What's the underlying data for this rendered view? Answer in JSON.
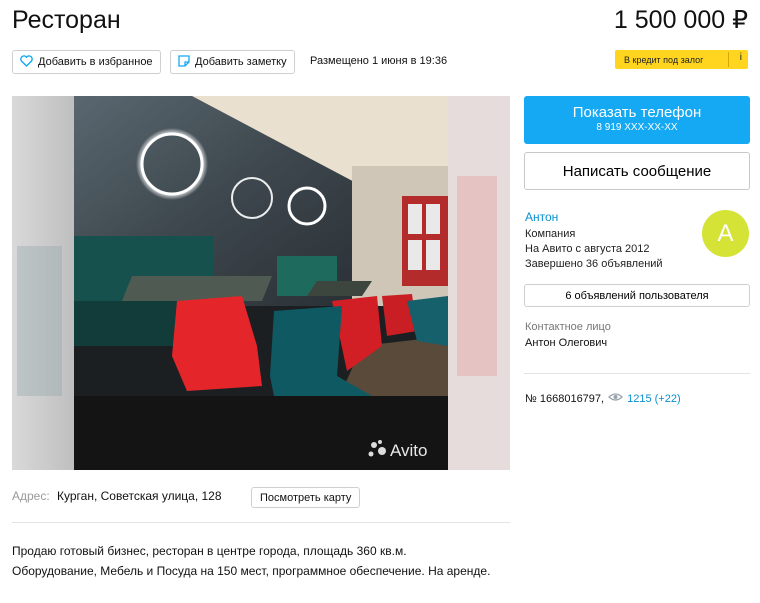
{
  "header": {
    "title": "Ресторан",
    "price": "1 500 000 ₽"
  },
  "actions": {
    "favorite_label": "Добавить в избранное",
    "note_label": "Добавить заметку",
    "posted": "Размещено 1 июня в 19:36",
    "credit_label": "В кредит под залог",
    "credit_info": "i"
  },
  "photo": {
    "watermark": "Avito"
  },
  "contact": {
    "show_phone_label": "Показать телефон",
    "phone_masked": "8 919 XXX-XX-XX",
    "message_label": "Написать сообщение"
  },
  "seller": {
    "name": "Антон",
    "type": "Компания",
    "since": "На Авито с августа 2012",
    "completed": "Завершено 36 объявлений",
    "avatar_letter": "А",
    "ads_button": "6 объявлений пользователя",
    "contact_label": "Контактное лицо",
    "contact_name": "Антон Олегович"
  },
  "meta": {
    "ad_number": "№ 1668016797,",
    "views": "1215 (+22)"
  },
  "address": {
    "label": "Адрес:",
    "value": "Курган, Советская улица, 128",
    "map_button": "Посмотреть карту"
  },
  "description": "Продаю готовый бизнес, ресторан в центре города, площадь 360 кв.м. Оборудование, Мебель и Посуда на 150 мест, программное обеспечение. На аренде.",
  "colors": {
    "accent": "#14a9f2",
    "link": "#0a90d0",
    "credit": "#ffd51f",
    "avatar": "#d5e236"
  }
}
